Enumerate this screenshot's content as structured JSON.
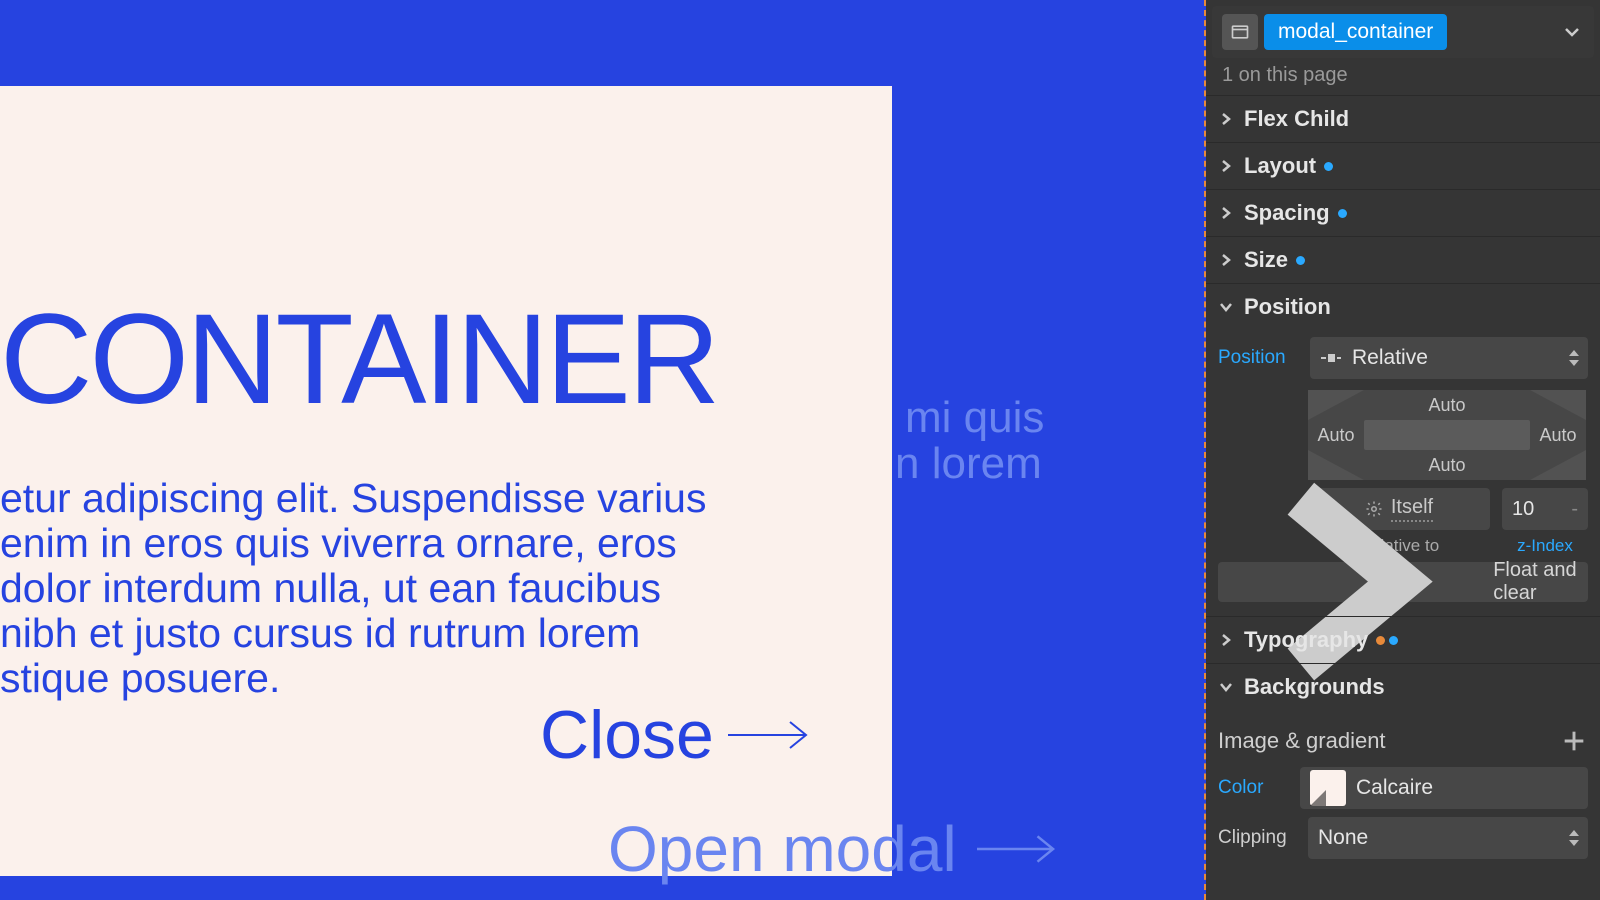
{
  "selector": {
    "class_name": "modal_container",
    "count_text": "1 on this page"
  },
  "sections": {
    "flex_child": "Flex Child",
    "layout": "Layout",
    "spacing": "Spacing",
    "size": "Size",
    "position": "Position",
    "typography": "Typography",
    "backgrounds": "Backgrounds"
  },
  "position": {
    "label": "Position",
    "value": "Relative",
    "offsets": {
      "top": "Auto",
      "right": "Auto",
      "bottom": "Auto",
      "left": "Auto"
    },
    "relative_to_value": "Itself",
    "relative_to_label": "Relative to",
    "z_index_value": "10",
    "z_index_label": "z-Index",
    "float_clear": "Float and clear"
  },
  "backgrounds": {
    "image_gradient": "Image & gradient",
    "color_label": "Color",
    "color_name": "Calcaire",
    "clipping_label": "Clipping",
    "clipping_value": "None"
  },
  "canvas": {
    "heading": "CONTAINER",
    "body": "etur adipiscing elit. Suspendisse varius enim in eros quis viverra ornare, eros dolor interdum nulla, ut ean faucibus nibh et justo cursus id rutrum lorem stique posuere.",
    "close": "Close",
    "bg_line1": "mi quis",
    "bg_line2": "n lorem",
    "open_modal": "Open modal"
  }
}
